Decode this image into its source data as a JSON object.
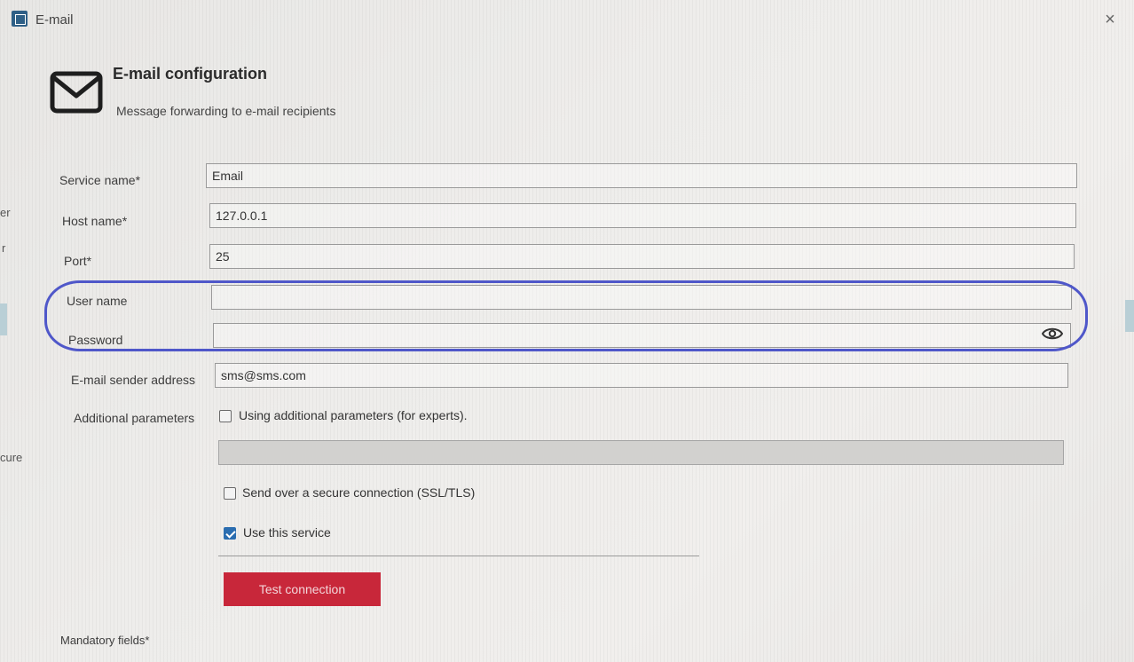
{
  "window": {
    "title": "E-mail",
    "close_symbol": "×"
  },
  "header": {
    "title": "E-mail configuration",
    "subtitle": "Message forwarding to e-mail recipients",
    "icon": "mail-icon"
  },
  "form": {
    "service_name": {
      "label": "Service name*",
      "value": "Email"
    },
    "host_name": {
      "label": "Host name*",
      "value": "127.0.0.1"
    },
    "port": {
      "label": "Port*",
      "value": "25"
    },
    "user_name": {
      "label": "User name",
      "value": ""
    },
    "password": {
      "label": "Password",
      "value": ""
    },
    "sender_address": {
      "label": "E-mail sender address",
      "value": "sms@sms.com"
    },
    "additional_parameters": {
      "label": "Additional parameters",
      "checkbox_label": "Using additional parameters (for experts).",
      "checked": false,
      "value": ""
    },
    "secure_connection": {
      "label": "Send over a secure connection (SSL/TLS)",
      "checked": false
    },
    "use_service": {
      "label": "Use this service",
      "checked": true
    }
  },
  "buttons": {
    "test_connection": "Test connection"
  },
  "footer": {
    "mandatory_note": "Mandatory fields*"
  },
  "background_fragments": {
    "left_1": "er",
    "left_2": "r",
    "left_3": "cure"
  },
  "colors": {
    "accent_button": "#c8273a",
    "highlight_outline": "#4f57c9",
    "checkbox_checked": "#2a6db0"
  }
}
